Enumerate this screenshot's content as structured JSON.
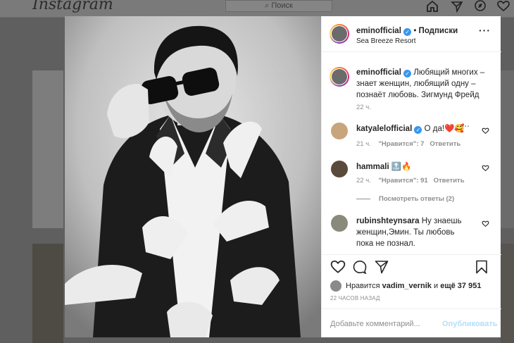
{
  "header": {
    "logo": "Instagram",
    "search_placeholder": "Поиск"
  },
  "post": {
    "author": "eminofficial",
    "dot_sep": "•",
    "follow_label": "Подписки",
    "location": "Sea Breeze Resort",
    "caption": "Любящий многих – знает женщин, любящий одну – познаёт любовь. Зигмунд Фрейд",
    "caption_time": "22 ч.",
    "likes_prefix": "Нравится",
    "likes_user": "vadim_vernik",
    "likes_and": "и",
    "likes_more": "ещё 37 951",
    "post_time": "22 ЧАСОВ НАЗАД",
    "comment_placeholder": "Добавьте комментарий...",
    "publish_label": "Опубликовать"
  },
  "comments": [
    {
      "user": "katyalelofficial",
      "text": "О да!❤️🥰",
      "time": "21 ч.",
      "likes": "\"Нравится\": 7",
      "reply": "Ответить"
    },
    {
      "user": "hammali",
      "text": "🔝🔥",
      "time": "22 ч.",
      "likes": "\"Нравится\": 91",
      "reply": "Ответить",
      "view_replies": "Посмотреть ответы (2)"
    },
    {
      "user": "rubinshteynsara",
      "text": "Ну знаешь женщин,Эмин. Ты любовь пока не познал."
    }
  ],
  "colors": {
    "accent": "#3897f0",
    "verified": "#3897f0",
    "publish_disabled": "#b2dffc"
  }
}
